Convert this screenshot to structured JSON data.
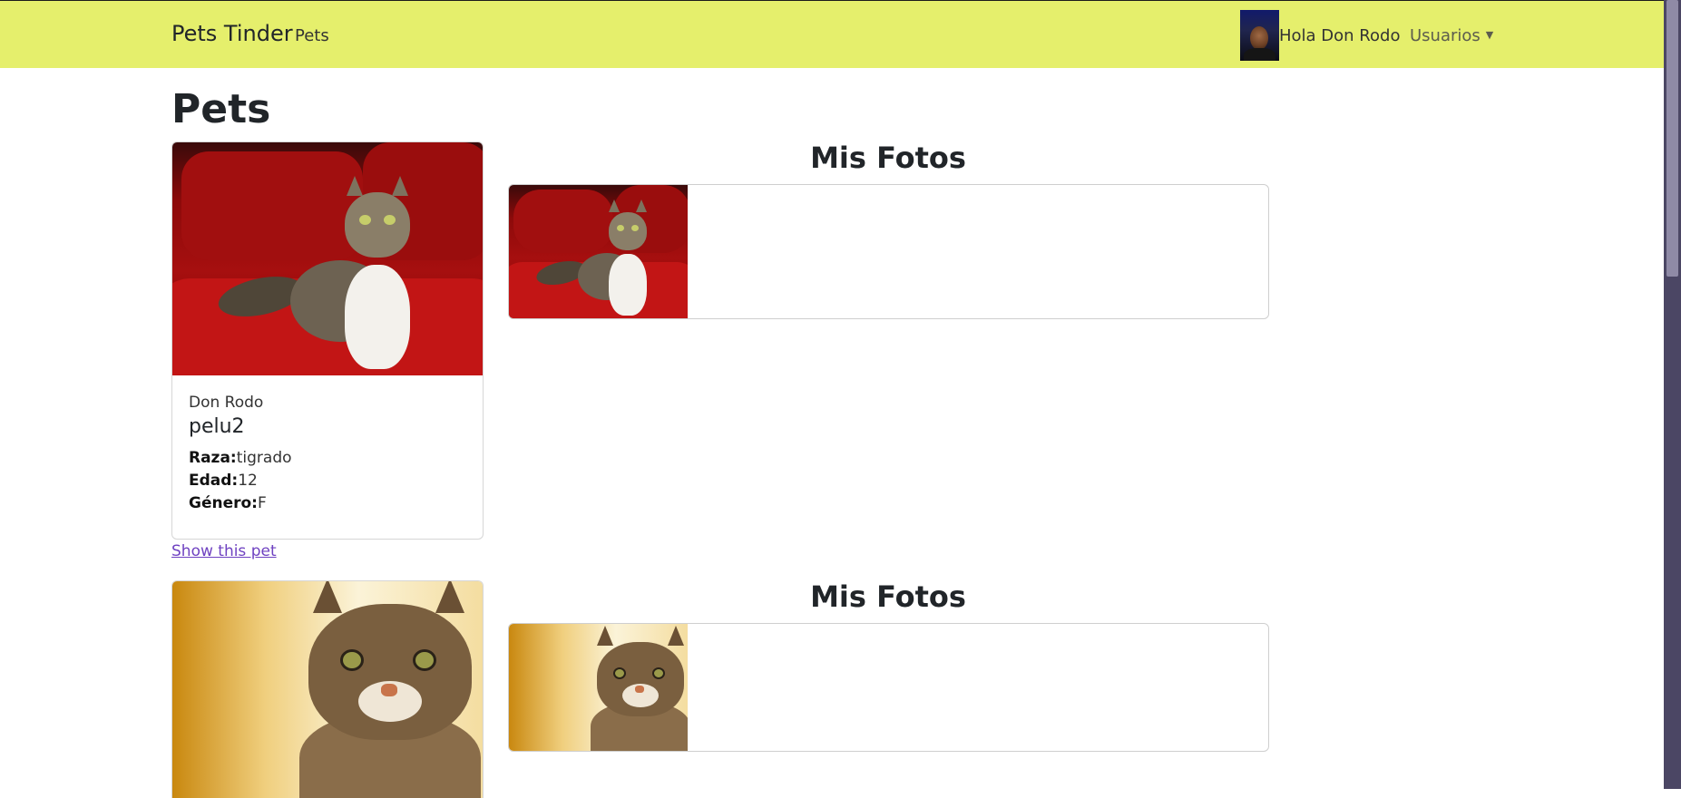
{
  "navbar": {
    "brand": "Pets Tinder",
    "pets_link": "Pets",
    "greeting": "Hola Don Rodo",
    "users_menu": "Usuarios",
    "bg_color": "#e5ef6c"
  },
  "page": {
    "title": "Pets"
  },
  "pets": [
    {
      "owner": "Don Rodo",
      "name": "pelu2",
      "raza_label": "Raza:",
      "raza": "tigrado",
      "edad_label": "Edad:",
      "edad": "12",
      "genero_label": "Género:",
      "genero": "F",
      "show_link": "Show this pet",
      "photos_title": "Mis Fotos"
    },
    {
      "photos_title": "Mis Fotos"
    }
  ],
  "colors": {
    "link": "#6f42c1",
    "scrollbar": "#4b4664"
  }
}
